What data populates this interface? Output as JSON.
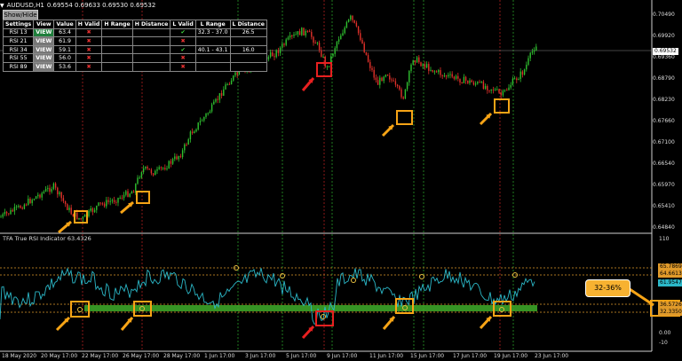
{
  "window": {
    "symbol": "AUDUSD,H1",
    "ohlc": "0.69554 0.69633 0.69530 0.69532"
  },
  "panel": {
    "show_hide": "Show/Hide",
    "headers": [
      "Settings",
      "View",
      "Value",
      "H Valid",
      "H Range",
      "H Distance",
      "L Valid",
      "L Range",
      "L Distance"
    ],
    "rows": [
      {
        "setting": "RSI 13",
        "view": "VIEW",
        "value": "63.4",
        "h_valid": "✖",
        "h_range": "",
        "h_distance": "",
        "l_valid": "✔",
        "l_range": "32.3 - 37.0",
        "l_distance": "26.5",
        "view_active": true
      },
      {
        "setting": "RSI 21",
        "view": "VIEW",
        "value": "61.9",
        "h_valid": "✖",
        "h_range": "",
        "h_distance": "",
        "l_valid": "✖",
        "l_range": "",
        "l_distance": "",
        "view_active": false
      },
      {
        "setting": "RSI 34",
        "view": "VIEW",
        "value": "59.1",
        "h_valid": "✖",
        "h_range": "",
        "h_distance": "",
        "l_valid": "✔",
        "l_range": "40.1 - 43.1",
        "l_distance": "16.0",
        "view_active": false
      },
      {
        "setting": "RSI 55",
        "view": "VIEW",
        "value": "56.0",
        "h_valid": "✖",
        "h_range": "",
        "h_distance": "",
        "l_valid": "✖",
        "l_range": "",
        "l_distance": "",
        "view_active": false
      },
      {
        "setting": "RSI 89",
        "view": "VIEW",
        "value": "53.6",
        "h_valid": "✖",
        "h_range": "",
        "h_distance": "",
        "l_valid": "✖",
        "l_range": "",
        "l_distance": "",
        "view_active": false
      }
    ]
  },
  "price_axis": {
    "labels": [
      "0.70490",
      "0.69920",
      "0.69360",
      "0.68790",
      "0.68230",
      "0.67660",
      "0.67100",
      "0.66540",
      "0.65970",
      "0.65410",
      "0.64840"
    ],
    "current_price": "0.69532"
  },
  "indicator": {
    "title": "TFA True RSI Indicator 63.4326",
    "axis_labels": [
      "110",
      "0.00",
      "-10"
    ],
    "level_tags": [
      "65.7869",
      "64.6613",
      "61.9547",
      "36.5726",
      "32.3350"
    ],
    "callout": "32-36%"
  },
  "time_axis": {
    "labels": [
      "18 May 2020",
      "20 May 17:00",
      "22 May 17:00",
      "26 May 17:00",
      "28 May 17:00",
      "1 Jun 17:00",
      "3 Jun 17:00",
      "5 Jun 17:00",
      "9 Jun 17:00",
      "11 Jun 17:00",
      "15 Jun 17:00",
      "17 Jun 17:00",
      "19 Jun 17:00",
      "23 Jun 17:00"
    ]
  },
  "colors": {
    "bull": "#2fbf2f",
    "bear": "#e0302a",
    "rsi_line": "#2bb8c8",
    "level_line": "#e09a2a",
    "green_band": "#3fae2a",
    "marker_orange": "#f7a416",
    "marker_red": "#e82020"
  }
}
